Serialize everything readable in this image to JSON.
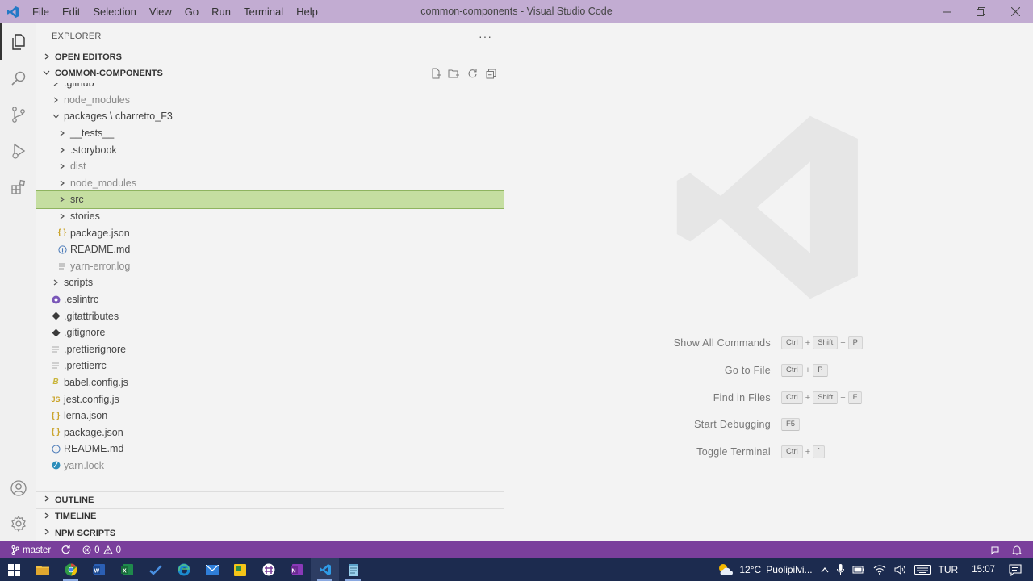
{
  "window": {
    "title": "common-components - Visual Studio Code",
    "menu": [
      "File",
      "Edit",
      "Selection",
      "View",
      "Go",
      "Run",
      "Terminal",
      "Help"
    ]
  },
  "explorer": {
    "header": "EXPLORER",
    "more": "···",
    "open_editors": "OPEN EDITORS",
    "workspace": "COMMON-COMPONENTS",
    "tree": [
      {
        "label": ".github",
        "indent": 0,
        "type": "folder",
        "dim": false
      },
      {
        "label": "node_modules",
        "indent": 0,
        "type": "folder",
        "dim": true
      },
      {
        "label": "packages \\ charretto_F3",
        "indent": 0,
        "type": "folder-open",
        "dim": false
      },
      {
        "label": "__tests__",
        "indent": 1,
        "type": "folder",
        "dim": false
      },
      {
        "label": ".storybook",
        "indent": 1,
        "type": "folder",
        "dim": false
      },
      {
        "label": "dist",
        "indent": 1,
        "type": "folder",
        "dim": true
      },
      {
        "label": "node_modules",
        "indent": 1,
        "type": "folder",
        "dim": true
      },
      {
        "label": "src",
        "indent": 1,
        "type": "folder",
        "dim": false,
        "selected": true
      },
      {
        "label": "stories",
        "indent": 1,
        "type": "folder",
        "dim": false
      },
      {
        "label": "package.json",
        "indent": 1,
        "type": "json",
        "dim": false
      },
      {
        "label": "README.md",
        "indent": 1,
        "type": "info",
        "dim": false
      },
      {
        "label": "yarn-error.log",
        "indent": 1,
        "type": "log",
        "dim": true
      },
      {
        "label": "scripts",
        "indent": 0,
        "type": "folder",
        "dim": false
      },
      {
        "label": ".eslintrc",
        "indent": 0,
        "type": "eslint",
        "dim": false
      },
      {
        "label": ".gitattributes",
        "indent": 0,
        "type": "git",
        "dim": false
      },
      {
        "label": ".gitignore",
        "indent": 0,
        "type": "git",
        "dim": false
      },
      {
        "label": ".prettierignore",
        "indent": 0,
        "type": "lines",
        "dim": false
      },
      {
        "label": ".prettierrc",
        "indent": 0,
        "type": "lines",
        "dim": false
      },
      {
        "label": "babel.config.js",
        "indent": 0,
        "type": "babel",
        "dim": false
      },
      {
        "label": "jest.config.js",
        "indent": 0,
        "type": "js",
        "dim": false
      },
      {
        "label": "lerna.json",
        "indent": 0,
        "type": "json",
        "dim": false
      },
      {
        "label": "package.json",
        "indent": 0,
        "type": "json",
        "dim": false
      },
      {
        "label": "README.md",
        "indent": 0,
        "type": "info",
        "dim": false
      },
      {
        "label": "yarn.lock",
        "indent": 0,
        "type": "yarn",
        "dim": true
      }
    ],
    "outline": "OUTLINE",
    "timeline": "TIMELINE",
    "npm_scripts": "NPM SCRIPTS"
  },
  "shortcuts": [
    {
      "label": "Show All Commands",
      "keys": [
        "Ctrl",
        "Shift",
        "P"
      ]
    },
    {
      "label": "Go to File",
      "keys": [
        "Ctrl",
        "P"
      ]
    },
    {
      "label": "Find in Files",
      "keys": [
        "Ctrl",
        "Shift",
        "F"
      ]
    },
    {
      "label": "Start Debugging",
      "keys": [
        "F5"
      ]
    },
    {
      "label": "Toggle Terminal",
      "keys": [
        "Ctrl",
        "`"
      ]
    }
  ],
  "status": {
    "branch": "master",
    "errors": "0",
    "warnings": "0"
  },
  "taskbar": {
    "temp": "12°C",
    "weather": "Puolipilvi...",
    "lang": "TUR",
    "time": "15:07"
  },
  "colors": {
    "titlebar": "#c2acd2",
    "statusbar": "#7a3f9c",
    "selection": "#c5dea1"
  }
}
